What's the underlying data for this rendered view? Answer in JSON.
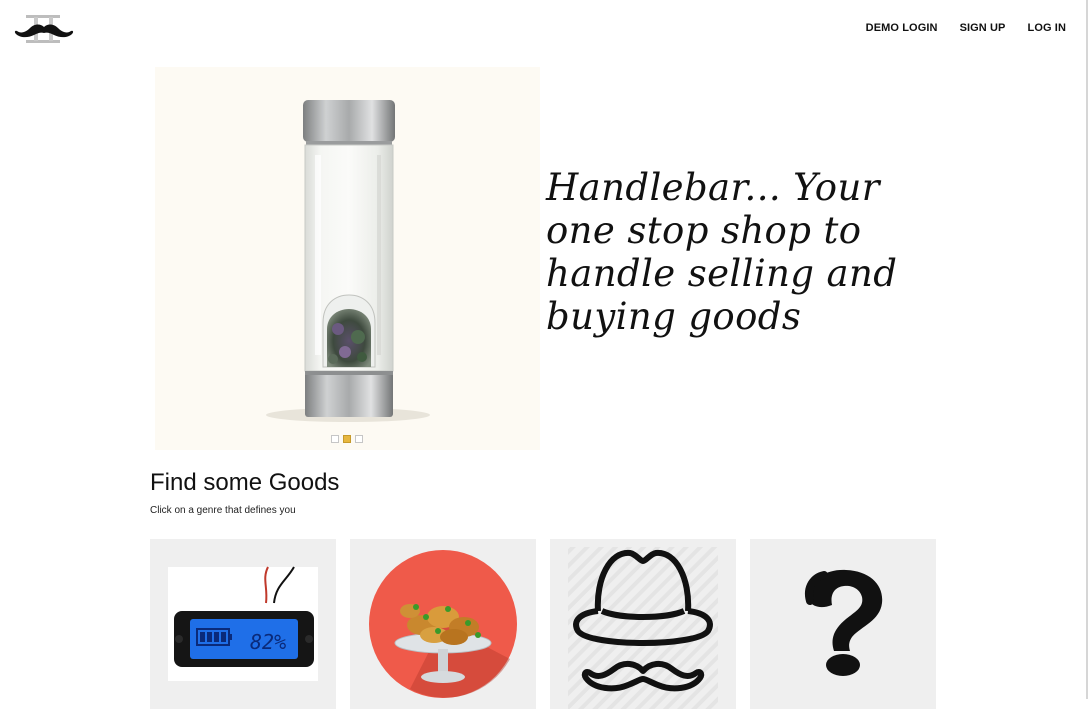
{
  "header": {
    "nav": {
      "demo_login": "DEMO LOGIN",
      "sign_up": "SIGN UP",
      "log_in": "LOG IN"
    }
  },
  "hero": {
    "tagline": "Handlebar... Your one stop shop to handle selling and buying goods",
    "carousel_active_index": 1,
    "carousel_count": 3
  },
  "section": {
    "title": "Find some Goods",
    "subtitle": "Click on a genre that defines you"
  },
  "genres": [
    {
      "icon": "battery-display-icon",
      "display_text": "82%"
    },
    {
      "icon": "food-platter-icon"
    },
    {
      "icon": "hat-mustache-icon"
    },
    {
      "icon": "question-mark-icon"
    }
  ],
  "colors": {
    "accent_dot": "#e7b73f",
    "card_bg": "#efefef",
    "battery_blue": "#1f6fe8",
    "plate_red": "#ef5a4a"
  }
}
